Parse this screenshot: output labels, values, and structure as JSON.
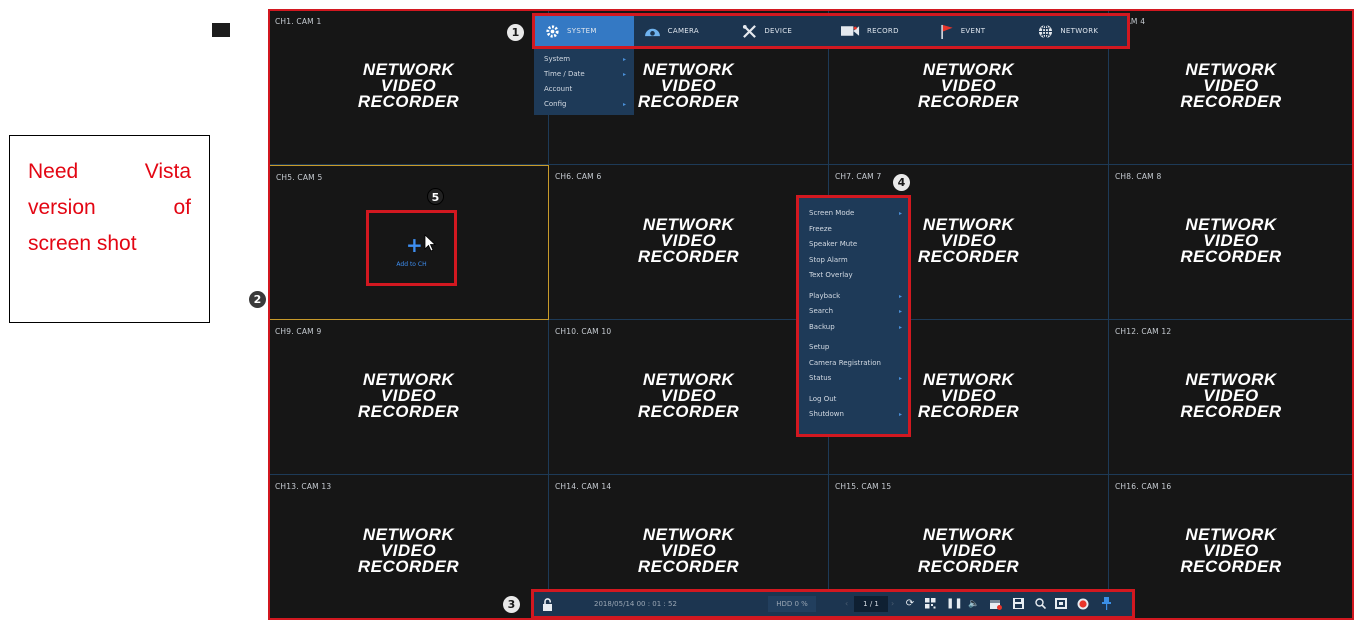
{
  "note": {
    "line1_left": "Need",
    "line1_right": "Vista",
    "line2_left": "version",
    "line2_right": "of",
    "line3": "screen shot"
  },
  "cells": [
    {
      "label": "CH1. CAM 1"
    },
    {
      "label": ""
    },
    {
      "label": ""
    },
    {
      "label": ". CAM 4"
    },
    {
      "label": "CH5. CAM 5"
    },
    {
      "label": "CH6. CAM 6"
    },
    {
      "label": "CH7. CAM 7"
    },
    {
      "label": "CH8. CAM 8"
    },
    {
      "label": "CH9. CAM 9"
    },
    {
      "label": "CH10. CAM 10"
    },
    {
      "label": ""
    },
    {
      "label": "CH12. CAM 12"
    },
    {
      "label": "CH13. CAM 13"
    },
    {
      "label": "CH14. CAM 14"
    },
    {
      "label": "CH15. CAM 15"
    },
    {
      "label": "CH16. CAM 16"
    }
  ],
  "logo": {
    "line1": "NETWORK",
    "line2": "VIDEO",
    "line3": "RECORDER"
  },
  "add_to_ch": "Add to CH",
  "topmenu": {
    "tabs": [
      {
        "label": "SYSTEM",
        "icon": "gear-icon"
      },
      {
        "label": "CAMERA",
        "icon": "camera-dome-icon"
      },
      {
        "label": "DEVICE",
        "icon": "tools-icon"
      },
      {
        "label": "RECORD",
        "icon": "video-camera-icon"
      },
      {
        "label": "EVENT",
        "icon": "flag-icon"
      },
      {
        "label": "NETWORK",
        "icon": "globe-icon"
      }
    ],
    "active_index": 0
  },
  "submenu": {
    "items": [
      {
        "label": "System",
        "arrow": "▸"
      },
      {
        "label": "Time / Date",
        "arrow": "▸"
      },
      {
        "label": "Account",
        "arrow": ""
      },
      {
        "label": "Config",
        "arrow": "▸"
      }
    ]
  },
  "context_menu": {
    "items": [
      {
        "label": "Screen Mode",
        "arrow": "▸"
      },
      {
        "label": "Freeze",
        "arrow": ""
      },
      {
        "label": "Speaker Mute",
        "arrow": ""
      },
      {
        "label": "Stop Alarm",
        "arrow": ""
      },
      {
        "label": "Text Overlay",
        "arrow": ""
      },
      {
        "label": "Playback",
        "arrow": "▸"
      },
      {
        "label": "Search",
        "arrow": "▸"
      },
      {
        "label": "Backup",
        "arrow": "▸"
      },
      {
        "label": "Setup",
        "arrow": ""
      },
      {
        "label": "Camera Registration",
        "arrow": ""
      },
      {
        "label": "Status",
        "arrow": "▸"
      },
      {
        "label": "Log Out",
        "arrow": ""
      },
      {
        "label": "Shutdown",
        "arrow": "▸"
      }
    ]
  },
  "statusbar": {
    "datetime": "2018/05/14 00 : 01 : 52",
    "hdd": "HDD 0 %",
    "page": "1 / 1"
  },
  "badges": {
    "b1": "1",
    "b2": "2",
    "b3": "3",
    "b4": "4",
    "b5": "5"
  },
  "colors": {
    "annotation_red": "#d21820",
    "note_text": "#e30613",
    "menu_bg": "#1c3550",
    "active_tab": "#3479c4",
    "add_blue": "#3e8ef0",
    "selected_border": "#c79a2a",
    "record_red": "#e8352b",
    "pin_blue": "#3b8fe6"
  }
}
